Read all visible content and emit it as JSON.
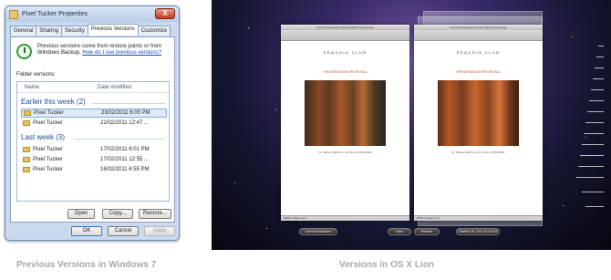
{
  "win7": {
    "title": "Pixel Tucker Properties",
    "close_label": "X",
    "tabs": [
      "General",
      "Sharing",
      "Security",
      "Previous Versions",
      "Customize"
    ],
    "description": "Previous versions come from restore points or from Windows Backup.",
    "help_link": "How do I use previous versions?",
    "folder_versions_label": "Folder versions:",
    "columns": {
      "name": "Name",
      "date": "Date modified"
    },
    "groups": [
      {
        "title": "Earlier this week (2)",
        "rows": [
          {
            "name": "Pixel Tucker",
            "date": "23/02/2011 6:05 PM",
            "selected": true
          },
          {
            "name": "Pixel Tucker",
            "date": "21/02/2011 12:47 ..."
          }
        ]
      },
      {
        "title": "Last week (3)",
        "rows": [
          {
            "name": "Pixel Tucker",
            "date": "17/02/2011 6:01 PM"
          },
          {
            "name": "Pixel Tucker",
            "date": "17/02/2011 12:55 ..."
          },
          {
            "name": "Pixel Tucker",
            "date": "16/02/2011 6:55 PM"
          }
        ]
      }
    ],
    "buttons": {
      "open": "Open",
      "copy": "Copy...",
      "restore": "Restore...",
      "ok": "OK",
      "cancel": "Cancel",
      "apply": "Apply"
    }
  },
  "lion": {
    "left_doc": {
      "title": "Forest Preservation Project (Word Processing)",
      "header": "SEQUOIA CLUB",
      "proposal": "PRESERVATION PROPOSAL",
      "caption": "Dr. Marley Robinson | Dr. Zhou | 10/16/2011",
      "status": "100% | Page 1 of 1"
    },
    "right_doc": {
      "title": "Forest Preservation Project (Word Processing)",
      "header": "SEQUOIA CLUB",
      "proposal": "PRESERVATION PROPOSAL",
      "caption": "Dr. Marley Robinson | Dr. Zhou | 10/16/2011",
      "status": "100% | Page 1 of 1"
    },
    "buttons": {
      "current_document": "Current Document",
      "done": "Done",
      "restore": "Restore",
      "timestamp": "October 16, 2011 11:47 AM"
    }
  },
  "captions": {
    "left": "Previous Versions in Windows 7",
    "right": "Versions in OS X Lion"
  }
}
